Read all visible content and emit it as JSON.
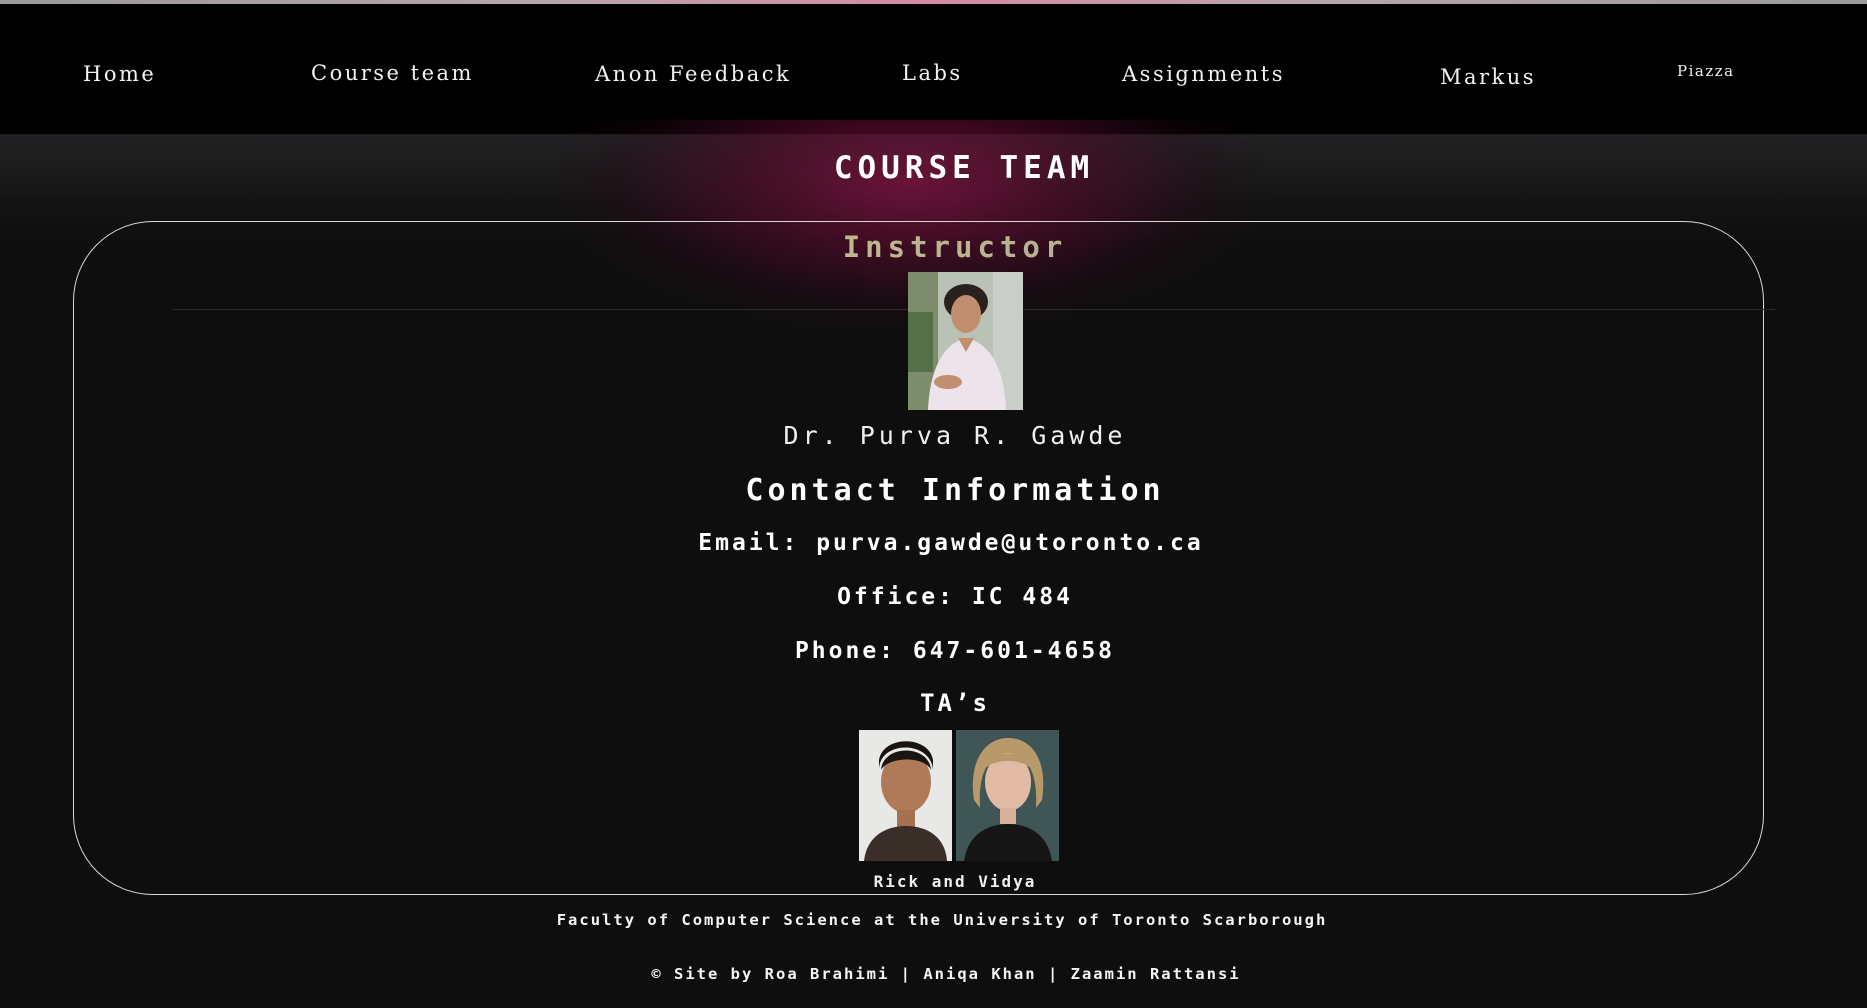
{
  "nav": {
    "items": [
      {
        "label": "Home"
      },
      {
        "label": "Course team"
      },
      {
        "label": "Anon Feedback"
      },
      {
        "label": "Labs"
      },
      {
        "label": "Assignments"
      },
      {
        "label": "Markus"
      },
      {
        "label": "Piazza"
      }
    ]
  },
  "page": {
    "title": "COURSE TEAM"
  },
  "instructor": {
    "section_label": "Instructor",
    "name": "Dr. Purva R. Gawde",
    "photo_icon": "instructor-photo"
  },
  "contact": {
    "heading": "Contact Information",
    "email": "Email: purva.gawde@utoronto.ca",
    "office": "Office: IC 484",
    "phone": "Phone: 647-601-4658"
  },
  "tas": {
    "heading": "TA’s",
    "caption": "Rick and Vidya",
    "photos": [
      "ta-photo-rick",
      "ta-photo-vidya"
    ]
  },
  "footer": {
    "faculty": "Faculty of Computer Science at the University of Toronto Scarborough",
    "credits": "© Site by Roa Brahimi | Aniqa Khan | Zaamin Rattansi"
  },
  "colors": {
    "background": "#0e0e0f",
    "navbar": "#000000",
    "accent_glow": "#78123c",
    "instructor_label": "#c9c07a"
  }
}
